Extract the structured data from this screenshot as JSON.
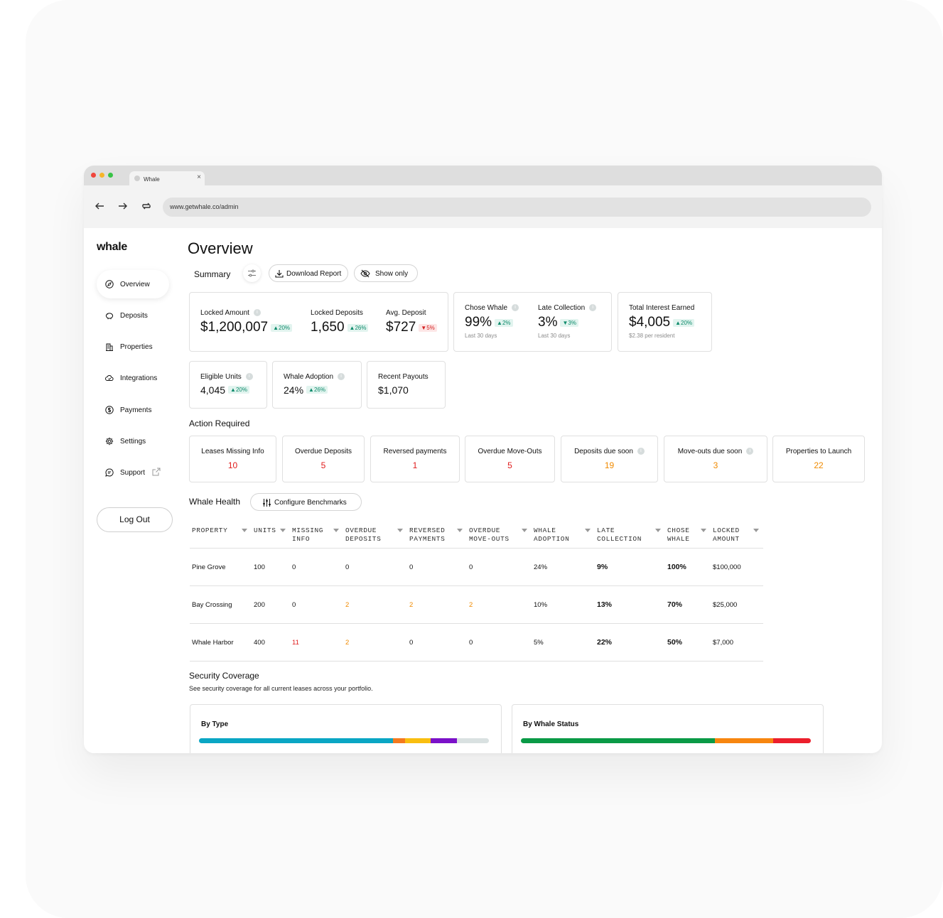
{
  "browser": {
    "tab_title": "Whale",
    "tab_close": "×",
    "url": "www.getwhale.co/admin"
  },
  "sidebar": {
    "logo": "whale",
    "items": [
      {
        "label": "Overview",
        "icon": "compass-icon"
      },
      {
        "label": "Deposits",
        "icon": "piggy-bank-icon"
      },
      {
        "label": "Properties",
        "icon": "building-icon"
      },
      {
        "label": "Integrations",
        "icon": "cloud-check-icon"
      },
      {
        "label": "Payments",
        "icon": "dollar-circle-icon"
      },
      {
        "label": "Settings",
        "icon": "gear-icon"
      },
      {
        "label": "Support",
        "icon": "chat-icon"
      }
    ],
    "logout": "Log Out"
  },
  "main": {
    "title": "Overview",
    "summary_label": "Summary",
    "download_report": "Download Report",
    "show_only": "Show only",
    "stats": {
      "locked_amount": {
        "label": "Locked Amount",
        "value": "$1,200,007",
        "change": "20%",
        "direction": "up"
      },
      "locked_deposits": {
        "label": "Locked Deposits",
        "value": "1,650",
        "change": "26%",
        "direction": "up"
      },
      "avg_deposit": {
        "label": "Avg. Deposit",
        "value": "$727",
        "change": "5%",
        "direction": "down"
      },
      "chose_whale": {
        "label": "Chose Whale",
        "value": "99%",
        "change": "2%",
        "direction": "up",
        "sub": "Last 30 days"
      },
      "late_collection": {
        "label": "Late Collection",
        "value": "3%",
        "change": "3%",
        "direction": "down",
        "sub": "Last 30 days"
      },
      "total_interest": {
        "label": "Total Interest Earned",
        "value": "$4,005",
        "change": "20%",
        "direction": "up",
        "sub": "$2.38 per resident"
      },
      "eligible_units": {
        "label": "Eligible Units",
        "value": "4,045",
        "change": "20%",
        "direction": "up"
      },
      "whale_adoption": {
        "label": "Whale Adoption",
        "value": "24%",
        "change": "26%",
        "direction": "up"
      },
      "recent_payouts": {
        "label": "Recent Payouts",
        "value": "$1,070"
      }
    },
    "action_required": {
      "title": "Action Required",
      "items": [
        {
          "label": "Leases Missing Info",
          "value": "10",
          "color": "#e01b1b"
        },
        {
          "label": "Overdue Deposits",
          "value": "5",
          "color": "#e01b1b"
        },
        {
          "label": "Reversed payments",
          "value": "1",
          "color": "#e01b1b"
        },
        {
          "label": "Overdue Move-Outs",
          "value": "5",
          "color": "#e01b1b"
        },
        {
          "label": "Deposits due soon",
          "value": "19",
          "color": "#f08a00"
        },
        {
          "label": "Move-outs due soon",
          "value": "3",
          "color": "#f08a00"
        },
        {
          "label": "Properties to Launch",
          "value": "22",
          "color": "#f08a00"
        }
      ]
    },
    "whale_health": {
      "title": "Whale Health",
      "configure": "Configure Benchmarks",
      "columns": [
        {
          "l1": "PROPERTY",
          "l2": ""
        },
        {
          "l1": "UNITS",
          "l2": ""
        },
        {
          "l1": "MISSING",
          "l2": "INFO"
        },
        {
          "l1": "OVERDUE",
          "l2": "DEPOSITS"
        },
        {
          "l1": "REVERSED",
          "l2": "PAYMENTS"
        },
        {
          "l1": "OVERDUE",
          "l2": "MOVE-OUTS"
        },
        {
          "l1": "WHALE",
          "l2": "ADOPTION"
        },
        {
          "l1": "LATE",
          "l2": "COLLECTION"
        },
        {
          "l1": "CHOSE",
          "l2": "WHALE"
        },
        {
          "l1": "LOCKED",
          "l2": "AMOUNT"
        }
      ],
      "rows": [
        [
          "Pine Grove",
          "100",
          "0",
          "0",
          "0",
          "0",
          "24%",
          "9%",
          "100%",
          "$100,000"
        ],
        [
          "Bay Crossing",
          "200",
          "0",
          "2",
          "2",
          "2",
          "10%",
          "13%",
          "70%",
          "$25,000"
        ],
        [
          "Whale Harbor",
          "400",
          "11",
          "2",
          "0",
          "0",
          "5%",
          "22%",
          "50%",
          "$7,000"
        ]
      ]
    },
    "security_coverage": {
      "title": "Security Coverage",
      "subtitle": "See security coverage for all current leases across your portfolio.",
      "by_type": {
        "title": "By Type",
        "segments": [
          {
            "share": 0.67,
            "color": "#0aa6c4"
          },
          {
            "share": 0.04,
            "color": "#f47a1f"
          },
          {
            "share": 0.09,
            "color": "#f9be10"
          },
          {
            "share": 0.09,
            "color": "#7b11c9"
          },
          {
            "share": 0.11,
            "color": "#d9e1e1"
          }
        ]
      },
      "by_status": {
        "title": "By Whale Status",
        "segments": [
          {
            "share": 0.67,
            "color": "#0a9a46"
          },
          {
            "share": 0.2,
            "color": "#f7860f"
          },
          {
            "share": 0.13,
            "color": "#ec1f2c"
          }
        ]
      }
    }
  }
}
